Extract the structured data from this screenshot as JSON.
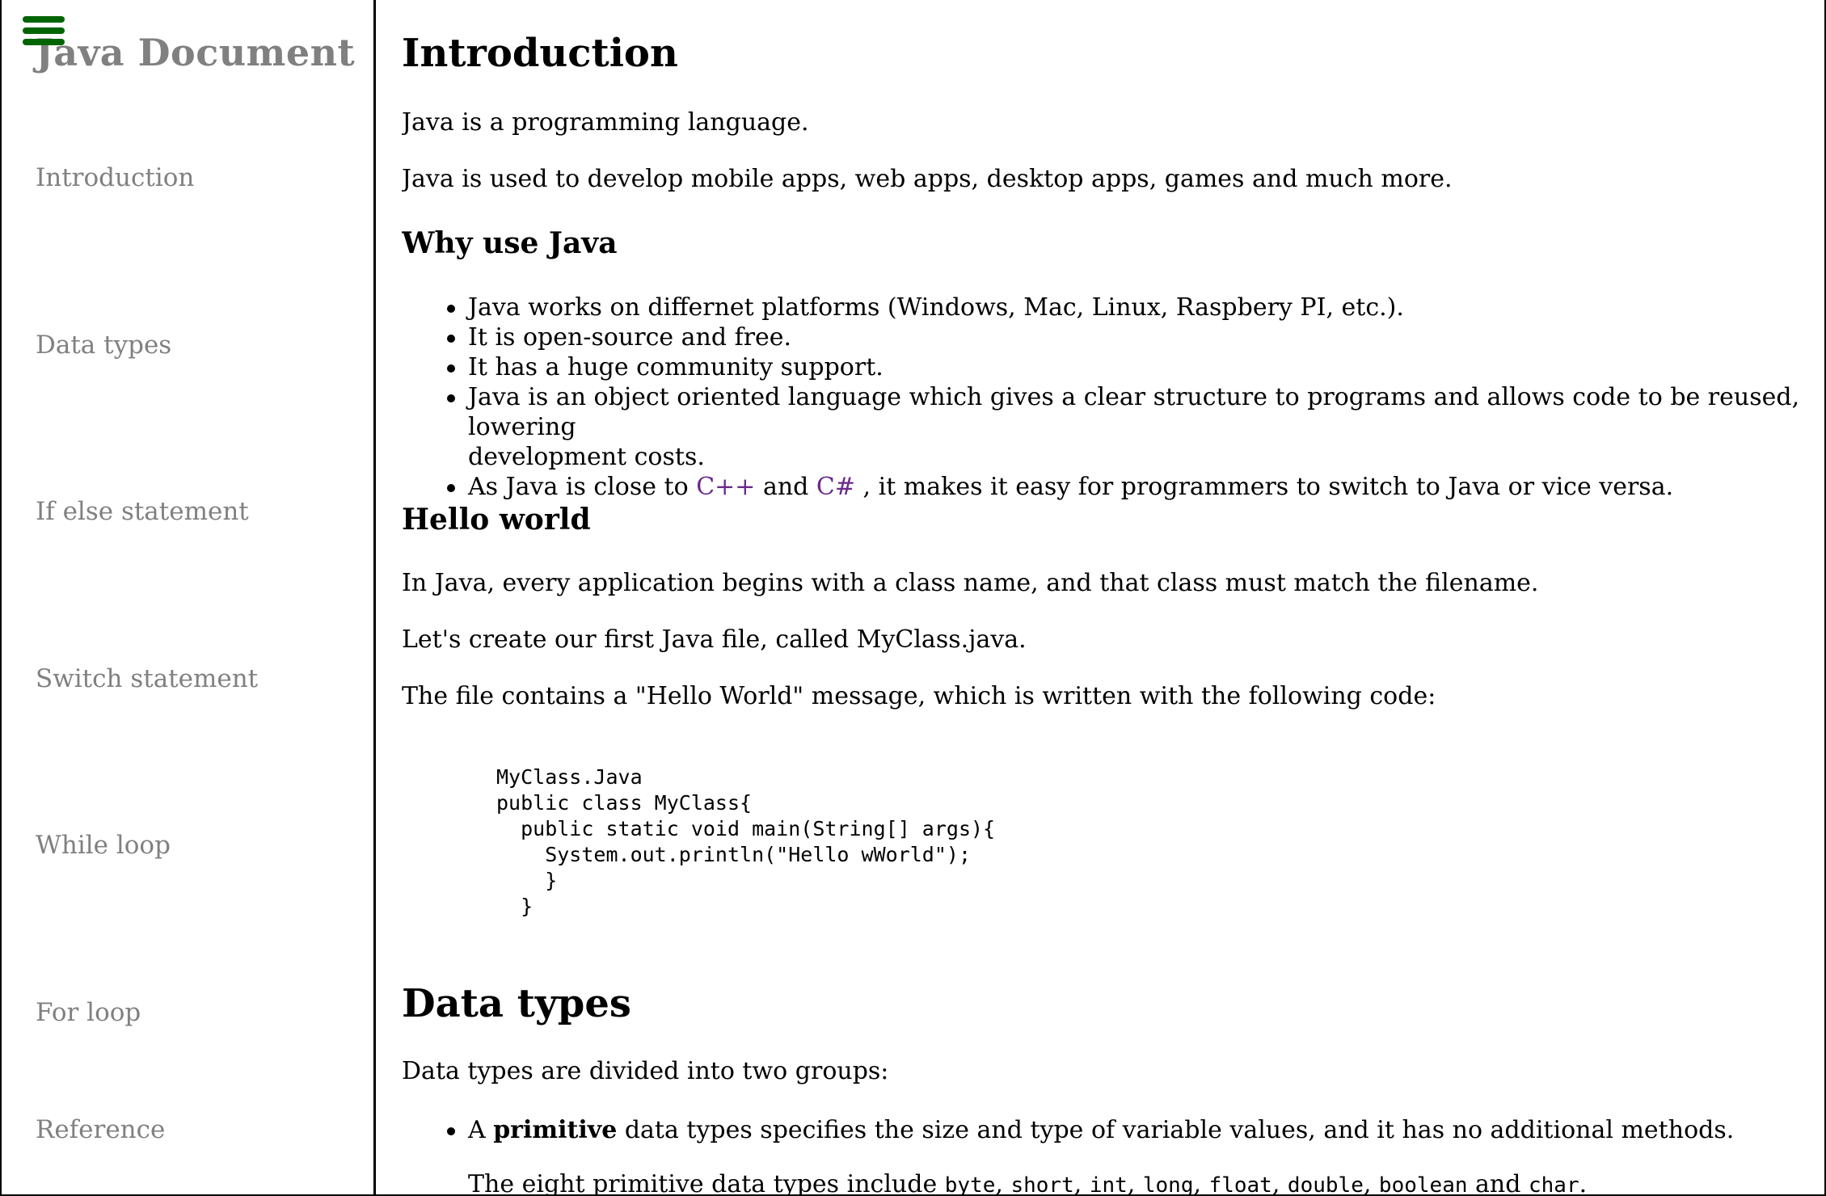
{
  "sidebar": {
    "title": "Java Document",
    "menu_icon": "hamburger-menu-icon",
    "items": [
      {
        "label": "Introduction"
      },
      {
        "label": "Data types"
      },
      {
        "label": "If else statement"
      },
      {
        "label": "Switch statement"
      },
      {
        "label": "While loop"
      },
      {
        "label": "For loop"
      },
      {
        "label": "Reference"
      }
    ]
  },
  "main": {
    "intro": {
      "heading": "Introduction",
      "p1": "Java is a programming language.",
      "p2": "Java is used to develop mobile apps, web apps, desktop apps, games and much more."
    },
    "why": {
      "heading": "Why use Java",
      "b1": "Java works on differnet platforms (Windows, Mac, Linux, Raspbery PI, etc.).",
      "b2": "It is open-source and free.",
      "b3": "It has a huge community support.",
      "b4_line1": "Java is an object oriented language which gives a clear structure to programs and allows code to be reused, lowering",
      "b4_line2": "development costs.",
      "b5_prefix": "As Java is close to ",
      "b5_link1": "C++",
      "b5_mid": " and ",
      "b5_link2": "C#",
      "b5_suffix": " , it makes it easy for programmers to switch to Java or vice versa."
    },
    "hello": {
      "heading": "Hello world",
      "p1": "In Java, every application begins with a class name, and that class must match the filename.",
      "p2": "Let's create our first Java file, called MyClass.java.",
      "p3": "The file contains a \"Hello World\" message, which is written with the following code:",
      "code": "MyClass.Java\npublic class MyClass{\n  public static void main(String[] args){\n    System.out.println(\"Hello wWorld\");\n    }\n  }"
    },
    "datatypes": {
      "heading": "Data types",
      "p1": "Data types are divided into two groups:",
      "b1_prefix": "A ",
      "b1_bold": "primitive",
      "b1_suffix": " data types specifies the size and type of variable values, and it has no additional methods.",
      "p2_prefix": "The eight primitive data types include ",
      "p2_types": [
        "byte",
        "short",
        "int",
        "long",
        "float",
        "double",
        "boolean"
      ],
      "p2_and": " and ",
      "p2_last": "char",
      "p2_end": "."
    },
    "colors": {
      "menu_icon": "#006400",
      "sidebar_text": "#808080",
      "link": "#6b2a8a"
    }
  }
}
